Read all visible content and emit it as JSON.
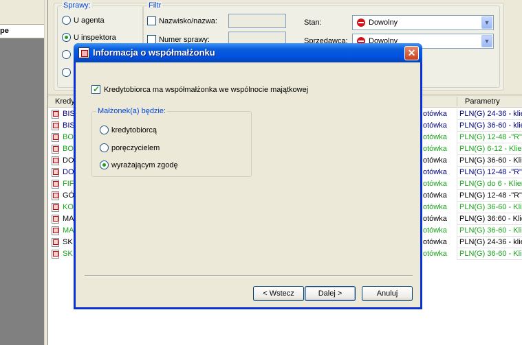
{
  "left_panel": {
    "row_label": "pe"
  },
  "filters": {
    "sprawy_title": "Sprawy:",
    "sprawy_options": [
      "U agenta",
      "U inspektora"
    ],
    "filtr_title": "Filtr",
    "nazwisko_label": "Nazwisko/nazwa:",
    "numer_label": "Numer sprawy:",
    "stan_label": "Stan:",
    "stan_value": "Dowolny",
    "sprzedawca_label": "Sprzedawca:",
    "sprzedawca_value": "Dowolny"
  },
  "grid": {
    "col_kredyt": "Kredy",
    "col_parametry": "Parametry",
    "rows": [
      {
        "name": "BIS",
        "product": "otówka",
        "params": "PLN(G) 24-36 - klie",
        "color": "blue"
      },
      {
        "name": "BIS",
        "product": "otówka",
        "params": "PLN(G) 36-60 - klie",
        "color": "blue"
      },
      {
        "name": "BO",
        "product": "otówka",
        "params": "PLN(G) 12-48 -\"R\"",
        "color": "green"
      },
      {
        "name": "BO",
        "product": "otówka",
        "params": "PLN(G) 6-12 - Klien",
        "color": "green"
      },
      {
        "name": "DO",
        "product": "otówka",
        "params": "PLN(G) 36-60 - Klie",
        "color": "black"
      },
      {
        "name": "DO",
        "product": "otówka",
        "params": "PLN(G) 12-48 -\"R\"",
        "color": "blue"
      },
      {
        "name": "FIF",
        "product": "otówka",
        "params": "PLN(G) do 6 - Klien",
        "color": "green"
      },
      {
        "name": "GÓ",
        "product": "otówka",
        "params": "PLN(G) 12-48 -\"R\"",
        "color": "black"
      },
      {
        "name": "KO",
        "product": "otówka",
        "params": "PLN(G) 36-60 - Klie",
        "color": "green"
      },
      {
        "name": "MA",
        "product": "otówka",
        "params": "PLN(G) 36:60 - Klie",
        "color": "black"
      },
      {
        "name": "MA",
        "product": "otówka",
        "params": "PLN(G) 36-60 - Klie",
        "color": "green"
      },
      {
        "name": "SK",
        "product": "otówka",
        "params": "PLN(G) 24-36 - klie",
        "color": "black"
      },
      {
        "name": "SK",
        "product": "otówka",
        "params": "PLN(G) 36-60 - Klie",
        "color": "green"
      }
    ]
  },
  "dialog": {
    "title": "Informacja o współmałżonku",
    "close_glyph": "✕",
    "checkbox_label": "Kredytobiorca ma współmałżonka we wspólnocie majątkowej",
    "checkbox_checked": true,
    "group_title": "Małżonek(a) będzie:",
    "options": [
      "kredytobiorcą",
      "poręczycielem",
      "wyrażającym zgodę"
    ],
    "selected_option": 2,
    "buttons": {
      "back": "< Wstecz",
      "next": "Dalej >",
      "cancel": "Anuluj"
    }
  },
  "colors": {
    "title_blue": "#0251e2",
    "green_text": "#1aa51a",
    "blue_text": "#000080",
    "stop_red": "#d3121a"
  },
  "icons": [
    "radio-icon",
    "checkbox-icon",
    "stop-icon",
    "dropdown-arrow-icon",
    "document-icon",
    "close-icon",
    "app-icon"
  ]
}
